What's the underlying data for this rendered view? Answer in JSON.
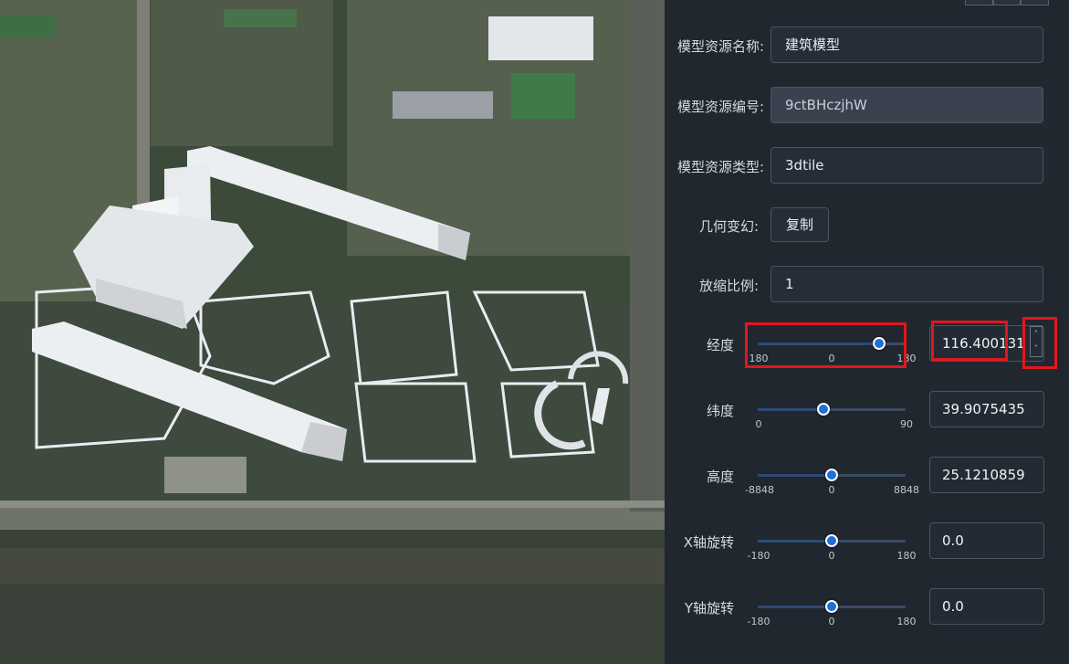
{
  "panel": {
    "fields": [
      {
        "label": "模型资源名称:",
        "value": "建筑模型",
        "disabled": false
      },
      {
        "label": "模型资源编号:",
        "value": "9ctBHczjhW",
        "disabled": true
      },
      {
        "label": "模型资源类型:",
        "value": "3dtile",
        "disabled": false
      }
    ],
    "transform": {
      "label": "几何变幻:",
      "button": "复制"
    },
    "scale": {
      "label": "放缩比例:",
      "value": "1"
    },
    "sliders": [
      {
        "label": "经度",
        "min_label": "180",
        "mid_label": "0",
        "max_label": "180",
        "min": -180,
        "max": 180,
        "value": 116.400131,
        "value_text": "116.400131"
      },
      {
        "label": "纬度",
        "min_label": "0",
        "mid_label": "",
        "max_label": "90",
        "min": 0,
        "max": 90,
        "value": 39.907543,
        "value_text": "39.9075435"
      },
      {
        "label": "高度",
        "min_label": "-8848",
        "mid_label": "0",
        "max_label": "8848",
        "min": -8848,
        "max": 8848,
        "value": 25.12,
        "value_text": "25.1210859"
      },
      {
        "label": "X轴旋转",
        "min_label": "-180",
        "mid_label": "0",
        "max_label": "180",
        "min": -180,
        "max": 180,
        "value": 0,
        "value_text": "0.0"
      },
      {
        "label": "Y轴旋转",
        "min_label": "-180",
        "mid_label": "0",
        "max_label": "180",
        "min": -180,
        "max": 180,
        "value": 0,
        "value_text": "0.0"
      }
    ],
    "stepper": {
      "up": "˄",
      "down": "˅"
    }
  },
  "colors": {
    "highlight": "#e1171b",
    "accent": "#1f6fd8"
  }
}
